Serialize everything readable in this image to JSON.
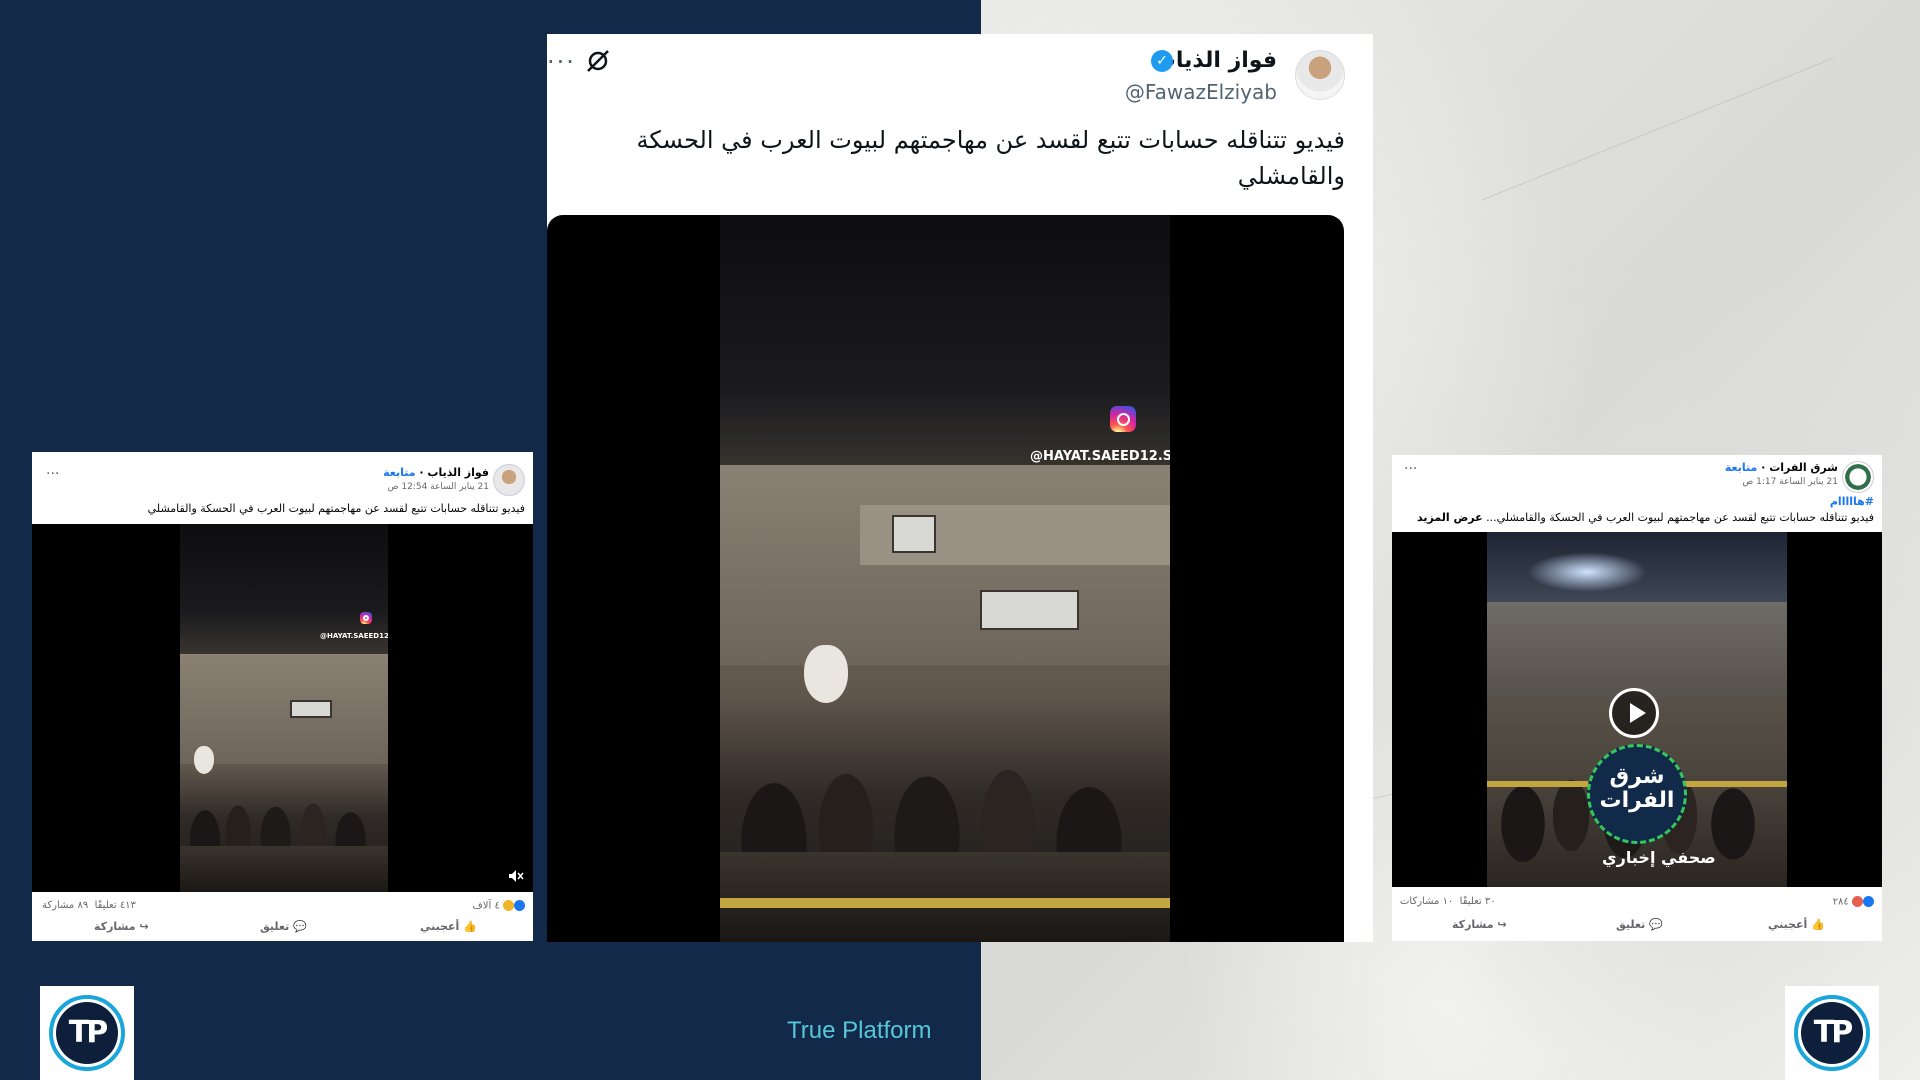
{
  "tweet": {
    "name": "فواز الذياب",
    "handle": "@FawazElziyab",
    "more": "···",
    "grok_icon": "grok-icon",
    "text": "فيديو تتناقله حسابات تتبع لقسد عن مهاجمتهم لبيوت العرب في الحسكة والقامشلي",
    "video_watermark": "@HAYAT.SAEED12.S"
  },
  "fb_left": {
    "name": "فواز الذياب",
    "follow": "متابعة",
    "meta": "21 يناير الساعة 12:54 ص",
    "more": "···",
    "text": "فيديو تتناقله حسابات تتبع لقسد عن مهاجمتهم لبيوت العرب في الحسكة والقامشلي",
    "watermark": "@HAYAT.SAEED12.S",
    "reactions": "٤ آلاف",
    "comments": "٤١٣ تعليقًا",
    "shares": "٨٩ مشاركة",
    "like": "أعجبني",
    "comment": "تعليق",
    "share": "مشاركة",
    "mute_icon": "speaker-muted-icon"
  },
  "fb_right": {
    "name": "شرق الفرات",
    "follow": "متابعة",
    "meta": "21 يناير الساعة 1:17 ص",
    "more": "···",
    "hashtag": "#هااااام",
    "text": "فيديو تتناقله حسابات تتبع لقسد عن مهاجمتهم لبيوت العرب في الحسكة والقامشلي...",
    "see_more": "عرض المزيد",
    "brand_line1": "شرق",
    "brand_line2": "الفرات",
    "brand_sub": "صحفي إخباري",
    "reactions": "٢٨٤",
    "comments": "٣٠ تعليقًا",
    "shares": "١٠ مشاركات",
    "like": "أعجبني",
    "comment": "تعليق",
    "share": "مشاركة"
  },
  "footer": {
    "label": "True Platform",
    "logo_text": "TP"
  },
  "colors": {
    "left_bg": "#13294a",
    "accent": "#56c7d9",
    "fb_blue": "#1877f2",
    "verified": "#1d9bf0"
  }
}
